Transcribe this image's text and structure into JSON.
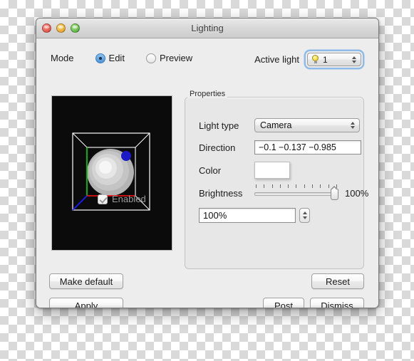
{
  "window": {
    "title": "Lighting",
    "traffic_lights": [
      "close-button",
      "minimize-button",
      "zoom-button"
    ]
  },
  "mode": {
    "label": "Mode",
    "options": [
      {
        "label": "Edit",
        "selected": true
      },
      {
        "label": "Preview",
        "selected": false
      }
    ]
  },
  "active_light": {
    "label": "Active light",
    "icon": "lightbulb-icon",
    "value": "1"
  },
  "viewport": {
    "name": "3d-light-preview",
    "background": "#0b0b0b",
    "axes": {
      "x": "#ff0000",
      "y": "#00c000",
      "z": "#0000ff"
    },
    "wireframe_color": "#ffffff",
    "sphere_color": "#c8c8c8",
    "marker_color": "#1414c8"
  },
  "properties": {
    "group_label": "Properties",
    "light_type": {
      "label": "Light type",
      "value": "Camera"
    },
    "direction": {
      "label": "Direction",
      "value": "−0.1 −0.137 −0.985"
    },
    "color": {
      "label": "Color",
      "value": "#ffffff"
    },
    "brightness": {
      "label": "Brightness",
      "slider_percent_label": "100%",
      "slider_value": 100,
      "tick_count": 11,
      "field_value": "100%"
    },
    "enabled": {
      "label": "Enabled",
      "checked": true,
      "disabled": true
    }
  },
  "buttons": {
    "make_default": "Make default",
    "apply": "Apply",
    "reset": "Reset",
    "post": "Post",
    "dismiss": "Dismiss"
  }
}
